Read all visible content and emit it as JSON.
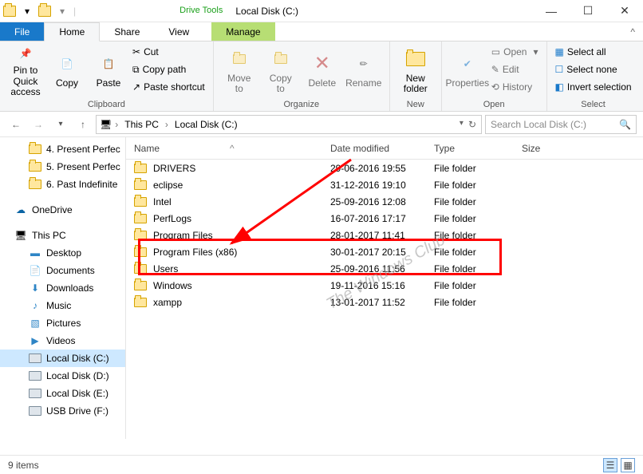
{
  "window": {
    "title": "Local Disk (C:)"
  },
  "tabs": {
    "file": "File",
    "home": "Home",
    "share": "Share",
    "view": "View",
    "drive_tools": "Drive Tools",
    "manage": "Manage"
  },
  "ribbon": {
    "clipboard": {
      "label": "Clipboard",
      "pin": "Pin to Quick\naccess",
      "copy": "Copy",
      "paste": "Paste",
      "cut": "Cut",
      "copy_path": "Copy path",
      "paste_shortcut": "Paste shortcut"
    },
    "organize": {
      "label": "Organize",
      "move_to": "Move\nto",
      "copy_to": "Copy\nto",
      "delete": "Delete",
      "rename": "Rename"
    },
    "new": {
      "label": "New",
      "new_folder": "New\nfolder"
    },
    "open": {
      "label": "Open",
      "properties": "Properties",
      "open": "Open",
      "edit": "Edit",
      "history": "History"
    },
    "select": {
      "label": "Select",
      "select_all": "Select all",
      "select_none": "Select none",
      "invert": "Invert selection"
    }
  },
  "breadcrumbs": {
    "this_pc": "This PC",
    "c": "Local Disk (C:)"
  },
  "search": {
    "placeholder": "Search Local Disk (C:)"
  },
  "tree": {
    "quick": [
      "4. Present Perfec",
      "5. Present Perfec",
      "6. Past Indefinite"
    ],
    "onedrive": "OneDrive",
    "this_pc": "This PC",
    "pc_children": [
      "Desktop",
      "Documents",
      "Downloads",
      "Music",
      "Pictures",
      "Videos",
      "Local Disk (C:)",
      "Local Disk (D:)",
      "Local Disk (E:)",
      "USB Drive (F:)"
    ]
  },
  "columns": {
    "name": "Name",
    "date": "Date modified",
    "type": "Type",
    "size": "Size"
  },
  "files": [
    {
      "name": "DRIVERS",
      "date": "29-06-2016 19:55",
      "type": "File folder"
    },
    {
      "name": "eclipse",
      "date": "31-12-2016 19:10",
      "type": "File folder"
    },
    {
      "name": "Intel",
      "date": "25-09-2016 12:08",
      "type": "File folder"
    },
    {
      "name": "PerfLogs",
      "date": "16-07-2016 17:17",
      "type": "File folder"
    },
    {
      "name": "Program Files",
      "date": "28-01-2017 11:41",
      "type": "File folder"
    },
    {
      "name": "Program Files (x86)",
      "date": "30-01-2017 20:15",
      "type": "File folder"
    },
    {
      "name": "Users",
      "date": "25-09-2016 11:56",
      "type": "File folder"
    },
    {
      "name": "Windows",
      "date": "19-11-2016 15:16",
      "type": "File folder"
    },
    {
      "name": "xampp",
      "date": "13-01-2017 11:52",
      "type": "File folder"
    }
  ],
  "status": {
    "text": "9 items"
  }
}
